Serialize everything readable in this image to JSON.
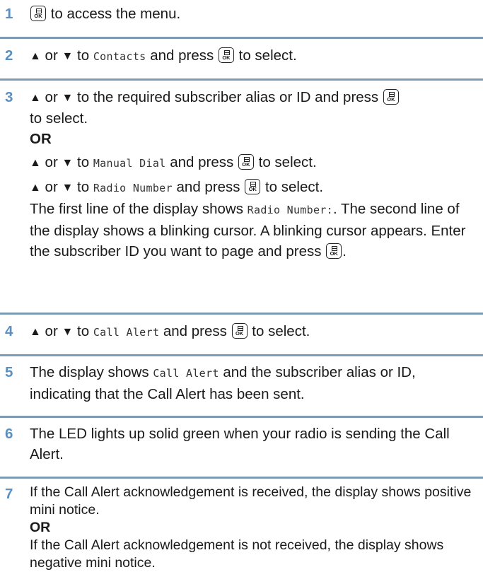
{
  "steps": [
    {
      "num": "1",
      "text": "to access the menu."
    },
    {
      "num": "2",
      "a": "or",
      "b": "to",
      "menu": "Contacts",
      "c": "and press",
      "d": "to select."
    },
    {
      "num": "3",
      "line1": "or",
      "line1b": "to the required subscriber alias or ID and press",
      "line2": "to select.",
      "or_label": "OR",
      "sub1_menu": "Manual Dial",
      "sub2_menu": "Radio Number",
      "para1": "The first line of the display shows",
      "para_menu": "Radio Number:",
      "para2": ". The second line of the display shows a blinking cursor. A blinking cursor appears. Enter the subscriber ID you want to page and press",
      "para_end": "."
    },
    {
      "num": "4",
      "menu": "Call Alert"
    },
    {
      "num": "5",
      "pre": "The display shows",
      "menu": "Call Alert",
      "post": "and the subscriber alias or ID, indicating that the Call Alert has been sent."
    },
    {
      "num": "6",
      "text": "The LED lights up solid green when your radio is sending the Call Alert."
    },
    {
      "num": "7",
      "text1": "If the Call Alert acknowledgement is received, the display shows positive mini notice.",
      "or_label": "OR",
      "text2": "If the Call Alert acknowledgement is not received, the display shows negative mini notice."
    }
  ],
  "icons": {
    "menu_ok_key": "menu-ok-button-icon",
    "up": "up-arrow-icon",
    "down": "down-arrow-icon"
  }
}
